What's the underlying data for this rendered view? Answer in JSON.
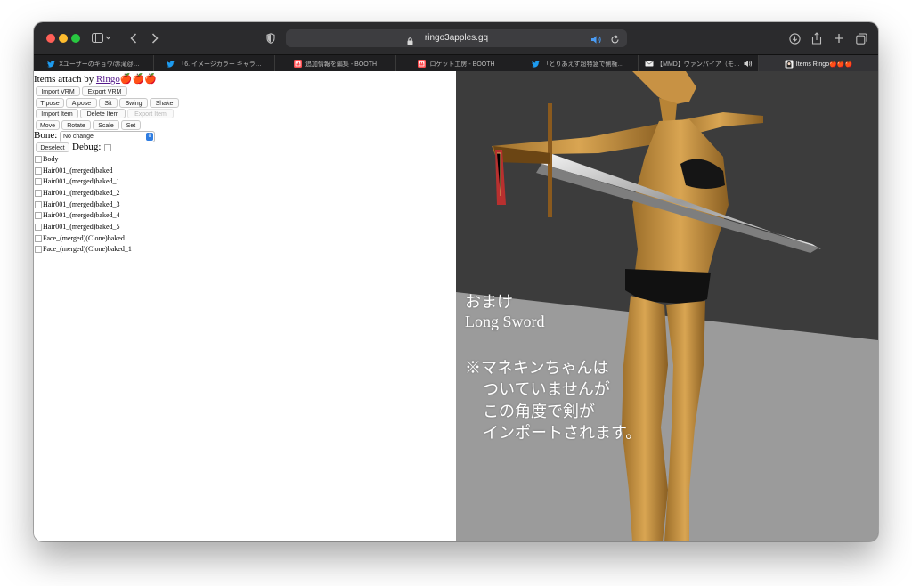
{
  "browser": {
    "url": "ringo3apples.gq",
    "tabs": [
      {
        "label": "Xユーザーのキョウ/赤滝@…",
        "icon": "twitter-icon"
      },
      {
        "label": "「6. イメージカラー キャラ…",
        "icon": "twitter-icon"
      },
      {
        "label": "追加情報を編集 - BOOTH",
        "icon": "booth-icon"
      },
      {
        "label": "ロケット工房 - BOOTH",
        "icon": "booth-icon"
      },
      {
        "label": "「とりあえず超特急で側権…",
        "icon": "twitter-icon"
      },
      {
        "label": "【MMD】ヴァンパイア（モ…",
        "icon": "mail-icon"
      },
      {
        "label": "Items Ringo🍎🍎🍎",
        "icon": "page-icon",
        "active": true
      }
    ]
  },
  "app": {
    "title_prefix": "Items attach by ",
    "title_link": "Ringo",
    "title_suffix": "🍎🍎🍎",
    "buttons": {
      "import_vrm": "Import VRM",
      "export_vrm": "Export VRM",
      "t_pose": "T pose",
      "a_pose": "A pose",
      "sit": "Sit",
      "swing": "Swing",
      "shake": "Shake",
      "import_item": "Import Item",
      "delete_item": "Delete Item",
      "export_item": "Export Item",
      "move": "Move",
      "rotate": "Rotate",
      "scale": "Scale",
      "set": "Set",
      "deselect": "Deselect"
    },
    "bone_label": "Bone:",
    "bone_value": "No change",
    "debug_label": "Debug:",
    "meshes": [
      "Body",
      "Hair001_(merged)baked",
      "Hair001_(merged)baked_1",
      "Hair001_(merged)baked_2",
      "Hair001_(merged)baked_3",
      "Hair001_(merged)baked_4",
      "Hair001_(merged)baked_5",
      "Face_(merged)(Clone)baked",
      "Face_(merged)(Clone)baked_1"
    ]
  },
  "overlay": {
    "line1": "おまけ",
    "line2": "Long Sword",
    "line3": "※マネキンちゃんは",
    "line4": "ついていませんが",
    "line5": "この角度で剣が",
    "line6": "インポートされます。"
  }
}
